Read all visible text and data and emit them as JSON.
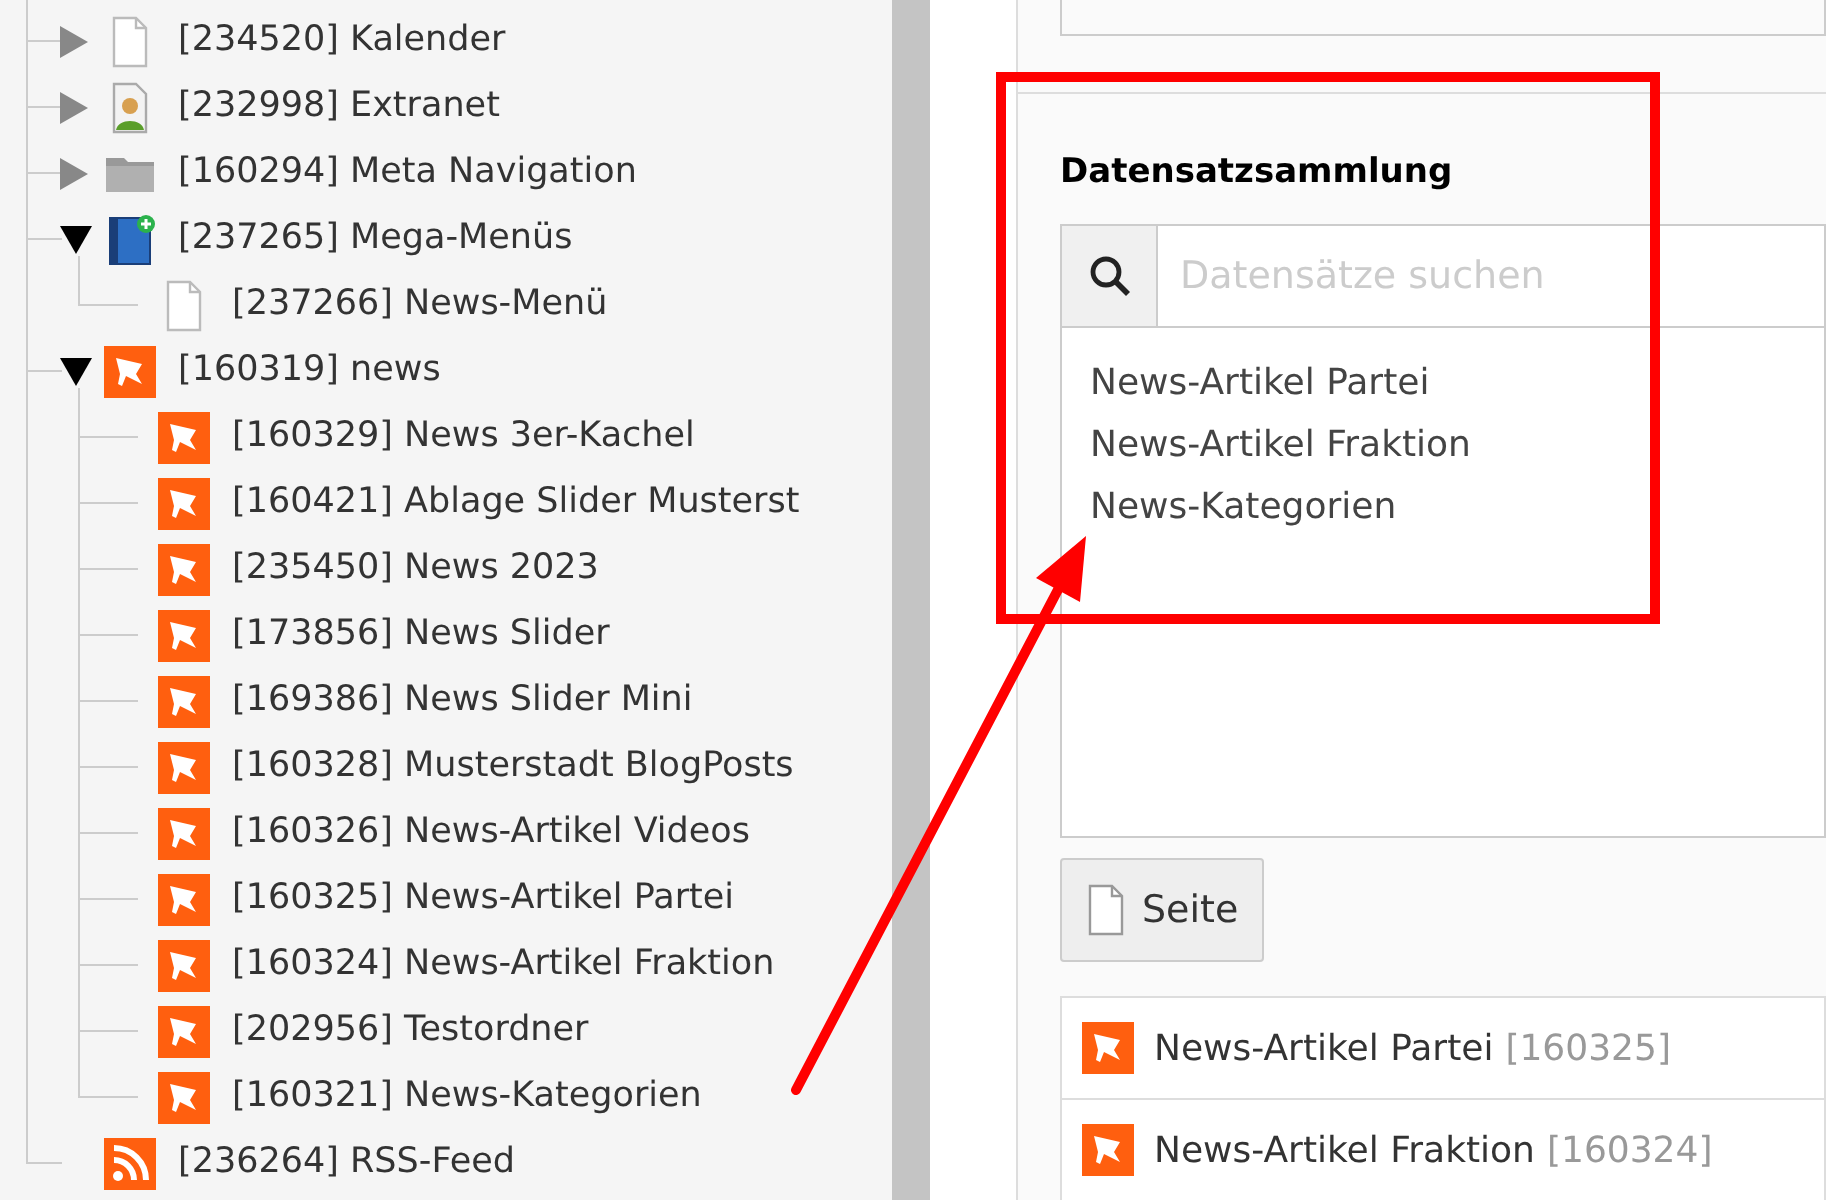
{
  "page_tree": [
    {
      "label": "[234520] Kalender",
      "kind": "page",
      "expanded": false
    },
    {
      "label": "[232998] Extranet",
      "kind": "user-page",
      "expanded": false
    },
    {
      "label": "[160294] Meta Navigation",
      "kind": "folder",
      "expanded": false
    },
    {
      "label": "[237265] Mega-Menüs",
      "kind": "book",
      "expanded": true,
      "children": [
        {
          "label": "[237266] News-Menü",
          "kind": "page"
        }
      ]
    },
    {
      "label": "[160319] news",
      "kind": "news",
      "expanded": true,
      "children": [
        {
          "label": "[160329] News 3er-Kachel",
          "kind": "news"
        },
        {
          "label": "[160421] Ablage Slider Musterst",
          "kind": "news"
        },
        {
          "label": "[235450] News 2023",
          "kind": "news"
        },
        {
          "label": "[173856] News Slider",
          "kind": "news"
        },
        {
          "label": "[169386] News Slider Mini",
          "kind": "news"
        },
        {
          "label": "[160328] Musterstadt BlogPosts",
          "kind": "news"
        },
        {
          "label": "[160326] News-Artikel Videos",
          "kind": "news"
        },
        {
          "label": "[160325] News-Artikel Partei",
          "kind": "news"
        },
        {
          "label": "[160324] News-Artikel Fraktion",
          "kind": "news"
        },
        {
          "label": "[202956] Testordner",
          "kind": "news"
        },
        {
          "label": "[160321] News-Kategorien",
          "kind": "news"
        }
      ]
    },
    {
      "label": "[236264] RSS-Feed",
      "kind": "rss"
    }
  ],
  "record_collection": {
    "heading": "Datensatzsammlung",
    "search": {
      "placeholder": "Datensätze suchen"
    },
    "options": [
      "News-Artikel Partei",
      "News-Artikel Fraktion",
      "News-Kategorien"
    ],
    "page_button": "Seite",
    "selected_records": [
      {
        "title": "News-Artikel Partei",
        "uid": "[160325]",
        "kind": "news"
      },
      {
        "title": "News-Artikel Fraktion",
        "uid": "[160324]",
        "kind": "news"
      }
    ]
  }
}
